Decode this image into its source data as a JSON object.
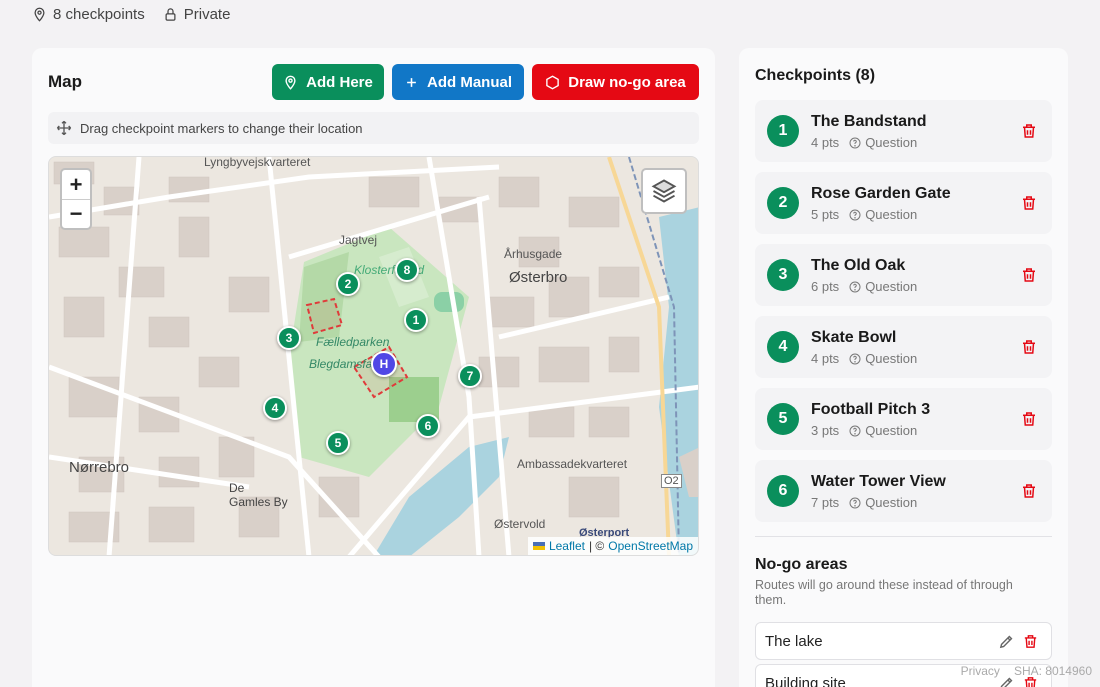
{
  "meta": {
    "checkpoints": "8 checkpoints",
    "visibility": "Private"
  },
  "map_panel": {
    "title": "Map",
    "buttons": {
      "add_here": "Add Here",
      "add_manual": "Add Manual",
      "draw_nogo": "Draw no-go area"
    },
    "hint": "Drag checkpoint markers to change their location",
    "zoom_in": "+",
    "zoom_out": "−",
    "attribution": {
      "leaflet": "Leaflet",
      "separator": "| ©",
      "osm": "OpenStreetMap"
    },
    "markers": [
      "1",
      "2",
      "3",
      "4",
      "5",
      "6",
      "7",
      "8"
    ],
    "home_marker": "H",
    "labels": {
      "park": "Fælledparken",
      "area": "Østerbro",
      "norrebro": "Nørrebro",
      "lyngby": "Lyngbyvejskvarteret",
      "gamles": "De Gamles By",
      "ostervold": "Østervold",
      "osterport": "Østerport",
      "jagtvej": "Jagtvej",
      "blegdams": "Blegdamsfælled",
      "klosterfalled": "Klosterfælled",
      "arhusgade": "Århusgade",
      "ambassade": "Ambassadekvarteret",
      "o2": "O2"
    }
  },
  "checkpoints_panel": {
    "title": "Checkpoints (8)",
    "items": [
      {
        "num": "1",
        "name": "The Bandstand",
        "pts": "4 pts",
        "type": "Question"
      },
      {
        "num": "2",
        "name": "Rose Garden Gate",
        "pts": "5 pts",
        "type": "Question"
      },
      {
        "num": "3",
        "name": "The Old Oak",
        "pts": "6 pts",
        "type": "Question"
      },
      {
        "num": "4",
        "name": "Skate Bowl",
        "pts": "4 pts",
        "type": "Question"
      },
      {
        "num": "5",
        "name": "Football Pitch 3",
        "pts": "3 pts",
        "type": "Question"
      },
      {
        "num": "6",
        "name": "Water Tower View",
        "pts": "7 pts",
        "type": "Question"
      }
    ],
    "nogo_title": "No-go areas",
    "nogo_desc": "Routes will go around these instead of through them.",
    "nogo_items": [
      "The lake",
      "Building site"
    ]
  },
  "footer": {
    "privacy": "Privacy",
    "sha": "SHA: 8014960"
  },
  "colors": {
    "green": "#0a8f5c",
    "blue": "#1177c7",
    "red": "#e50914",
    "home": "#5047e5"
  }
}
